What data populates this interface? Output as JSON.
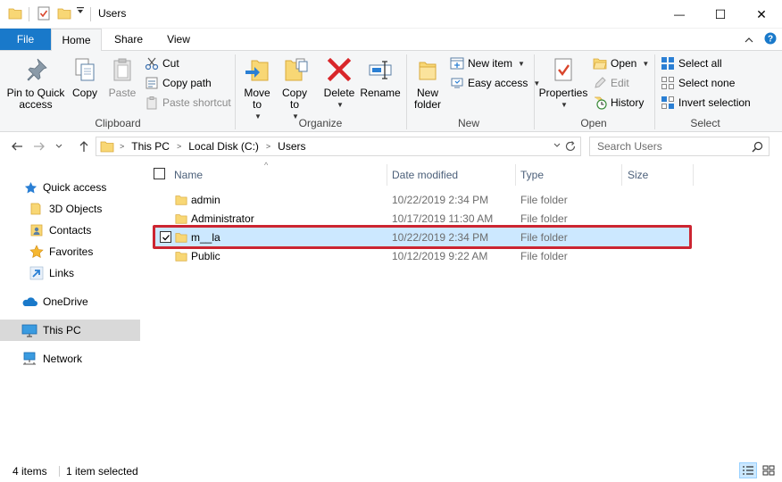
{
  "window": {
    "title": "Users",
    "minimize_glyph": "—",
    "maximize_glyph": "☐",
    "close_glyph": "✕"
  },
  "tabs": {
    "file": "File",
    "home": "Home",
    "share": "Share",
    "view": "View"
  },
  "ribbon": {
    "clipboard": {
      "label": "Clipboard",
      "pin": "Pin to Quick access",
      "copy": "Copy",
      "paste": "Paste",
      "cut": "Cut",
      "copy_path": "Copy path",
      "paste_shortcut": "Paste shortcut"
    },
    "organize": {
      "label": "Organize",
      "move_to": "Move to",
      "copy_to": "Copy to",
      "delete": "Delete",
      "rename": "Rename"
    },
    "new": {
      "label": "New",
      "new_folder": "New folder",
      "new_item": "New item",
      "easy_access": "Easy access"
    },
    "open": {
      "label": "Open",
      "properties": "Properties",
      "open": "Open",
      "edit": "Edit",
      "history": "History"
    },
    "select": {
      "label": "Select",
      "select_all": "Select all",
      "select_none": "Select none",
      "invert_selection": "Invert selection"
    }
  },
  "address": {
    "crumbs": [
      "This PC",
      "Local Disk (C:)",
      "Users"
    ],
    "search_placeholder": "Search Users"
  },
  "navpane": {
    "quick_access": "Quick access",
    "objects_3d": "3D Objects",
    "contacts": "Contacts",
    "favorites": "Favorites",
    "links": "Links",
    "onedrive": "OneDrive",
    "this_pc": "This PC",
    "network": "Network"
  },
  "columns": {
    "name": "Name",
    "date_modified": "Date modified",
    "type": "Type",
    "size": "Size"
  },
  "files": [
    {
      "name": "admin",
      "date": "10/22/2019 2:34 PM",
      "type": "File folder"
    },
    {
      "name": "Administrator",
      "date": "10/17/2019 11:30 AM",
      "type": "File folder"
    },
    {
      "name": "m__la",
      "date": "10/22/2019 2:34 PM",
      "type": "File folder"
    },
    {
      "name": "Public",
      "date": "10/12/2019 9:22 AM",
      "type": "File folder"
    }
  ],
  "status": {
    "item_count": "4 items",
    "selected": "1 item selected"
  },
  "colors": {
    "accent": "#1979ca",
    "selection": "#cce8ff",
    "highlight_border": "#cc2531",
    "folder": "#f8d775"
  }
}
